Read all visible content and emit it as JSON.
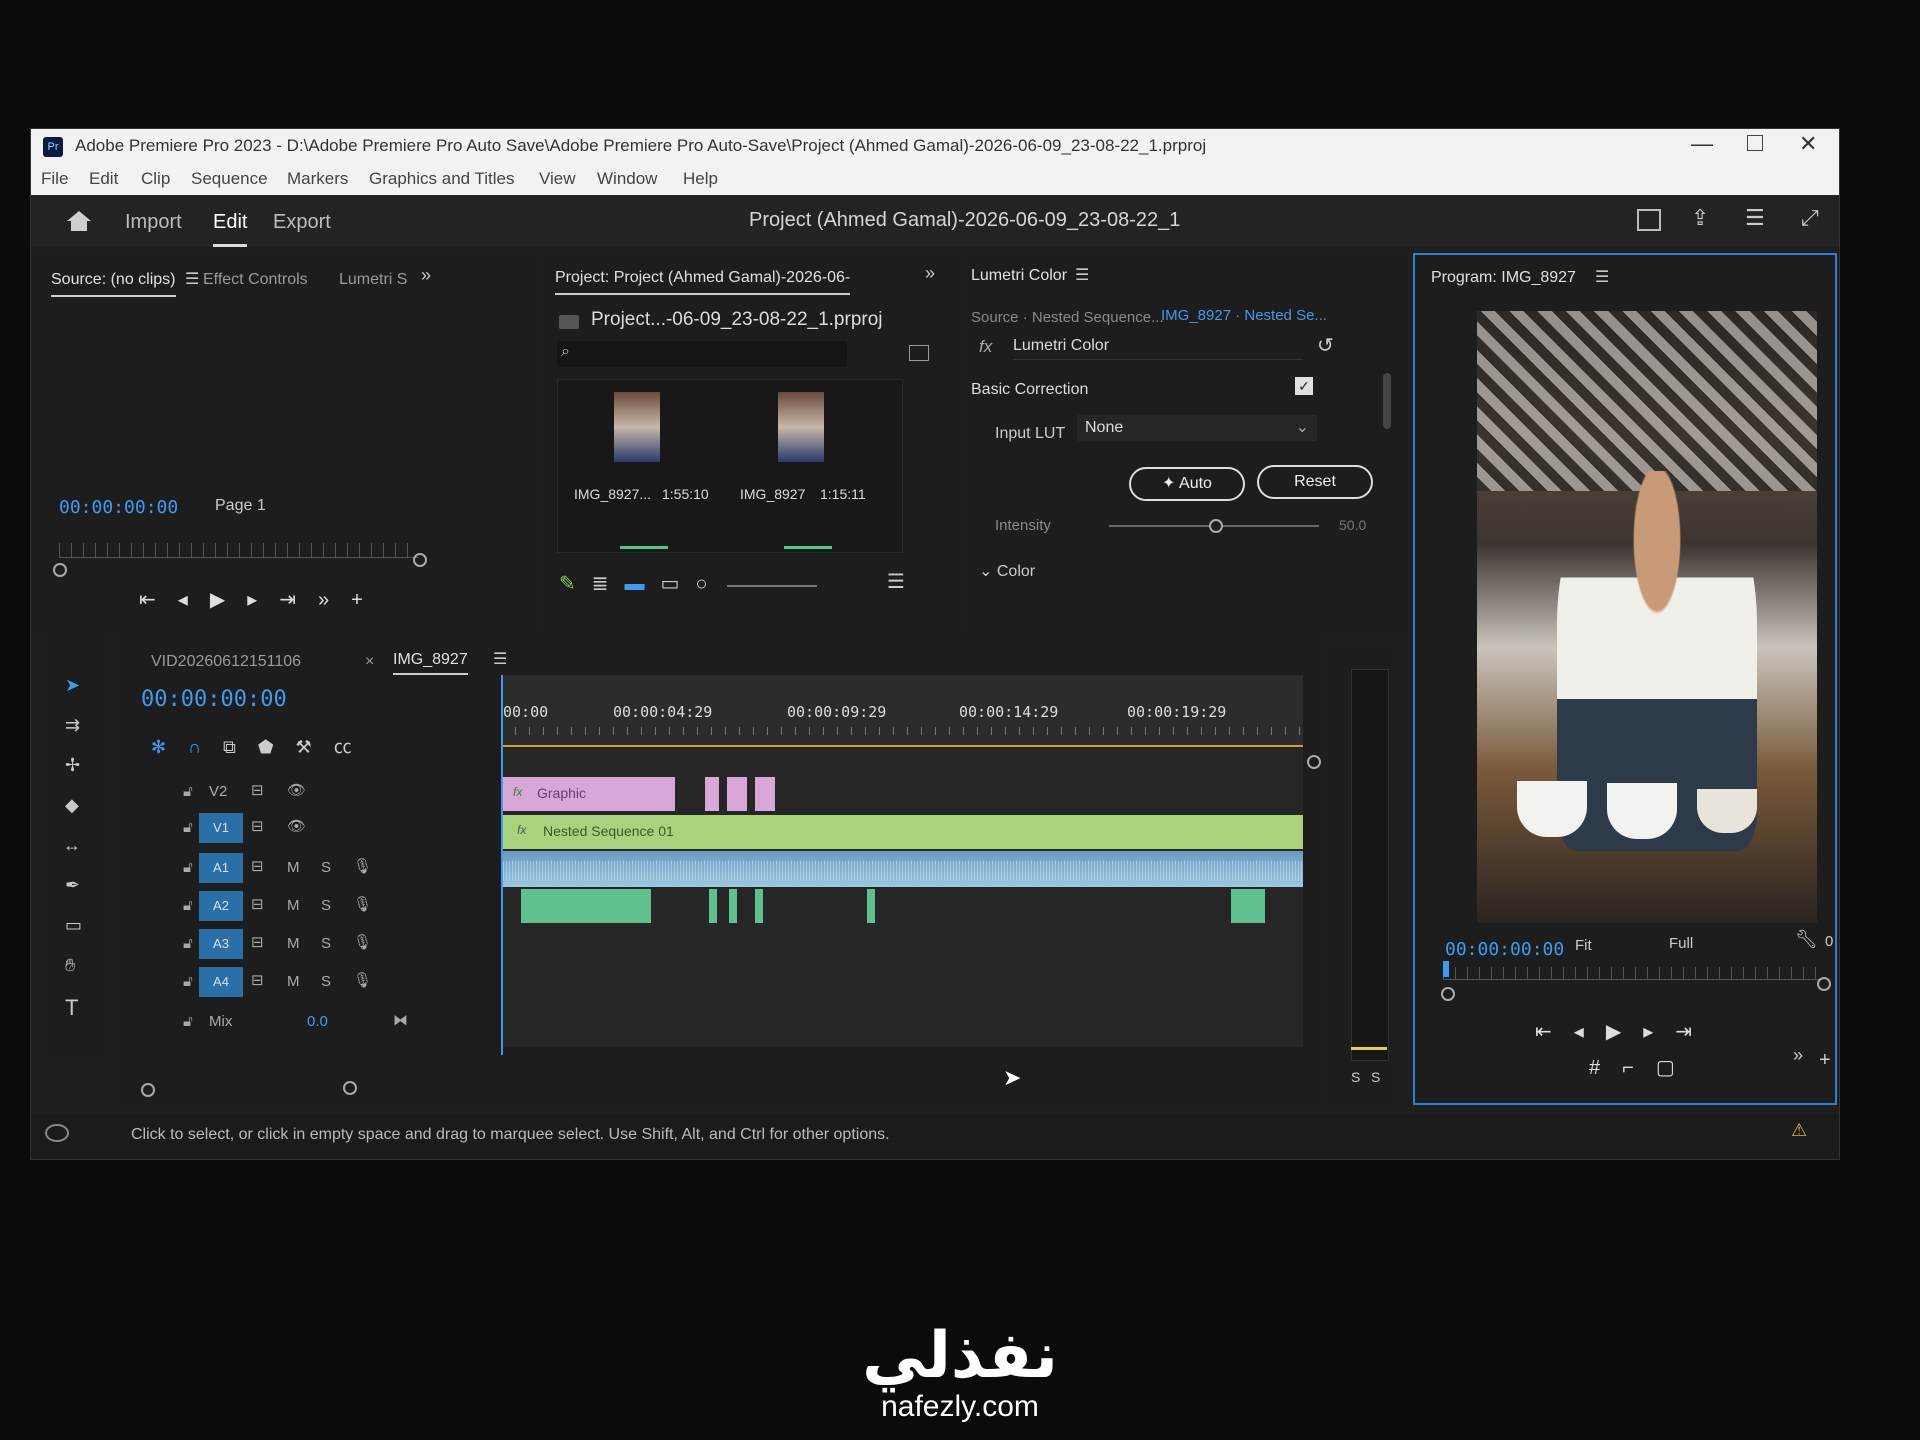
{
  "window": {
    "title": "Adobe Premiere Pro 2023 - D:\\Adobe Premiere Pro Auto Save\\Adobe Premiere Pro Auto-Save\\Project (Ahmed Gamal)-2026-06-09_23-08-22_1.prproj",
    "app_icon": "Pr"
  },
  "menu": [
    "File",
    "Edit",
    "Clip",
    "Sequence",
    "Markers",
    "Graphics and Titles",
    "View",
    "Window",
    "Help"
  ],
  "header": {
    "tabs": [
      "Import",
      "Edit",
      "Export"
    ],
    "active_tab": "Edit",
    "project_title": "Project (Ahmed Gamal)-2026-06-09_23-08-22_1"
  },
  "source_panel": {
    "tabs": [
      "Source: (no clips)",
      "Effect Controls",
      "Lumetri S"
    ],
    "timecode": "00:00:00:00",
    "page": "Page 1"
  },
  "project_panel": {
    "tab": "Project: Project (Ahmed Gamal)-2026-06-",
    "file": "Project...-06-09_23-08-22_1.prproj",
    "items": [
      {
        "name": "IMG_8927...",
        "duration": "1:55:10"
      },
      {
        "name": "IMG_8927",
        "duration": "1:15:11"
      }
    ]
  },
  "lumetri_panel": {
    "tab": "Lumetri Color",
    "source_label": "Source · Nested Sequence...",
    "target_label": "IMG_8927 · Nested Se...",
    "fx_label": "Lumetri Color",
    "section": "Basic Correction",
    "input_lut_label": "Input LUT",
    "input_lut_value": "None",
    "auto_label": "Auto",
    "reset_label": "Reset",
    "intensity_label": "Intensity",
    "intensity_value": "50.0",
    "color_label": "Color"
  },
  "timeline": {
    "tabs": [
      "VID20260612151106",
      "IMG_8927"
    ],
    "timecode": "00:00:00:00",
    "ruler": [
      "00:00",
      "00:00:04:29",
      "00:00:09:29",
      "00:00:14:29",
      "00:00:19:29"
    ],
    "tracks": [
      {
        "id": "V2",
        "type": "video"
      },
      {
        "id": "V1",
        "type": "video"
      },
      {
        "id": "A1",
        "type": "audio"
      },
      {
        "id": "A2",
        "type": "audio"
      },
      {
        "id": "A3",
        "type": "audio"
      },
      {
        "id": "A4",
        "type": "audio"
      }
    ],
    "audio_btns": [
      "M",
      "S"
    ],
    "mix_label": "Mix",
    "mix_value": "0.0",
    "clips": {
      "graphic": "Graphic",
      "nested": "Nested Sequence 01",
      "fx": "fx"
    }
  },
  "meter": {
    "labels": [
      "S",
      "S"
    ]
  },
  "program_panel": {
    "tab": "Program: IMG_8927",
    "timecode": "00:00:00:00",
    "fit": "Fit",
    "quality": "Full",
    "tail": "0"
  },
  "status_bar": "Click to select, or click in empty space and drag to marquee select. Use Shift, Alt, and Ctrl for other options.",
  "watermark": {
    "arabic": "نفذلي",
    "url": "nafezly.com"
  },
  "colors": {
    "accent": "#3d9bf0",
    "graphic_clip": "#d9a6d8",
    "nested_clip": "#a8d37c",
    "audio_clip": "#5fc28e"
  }
}
